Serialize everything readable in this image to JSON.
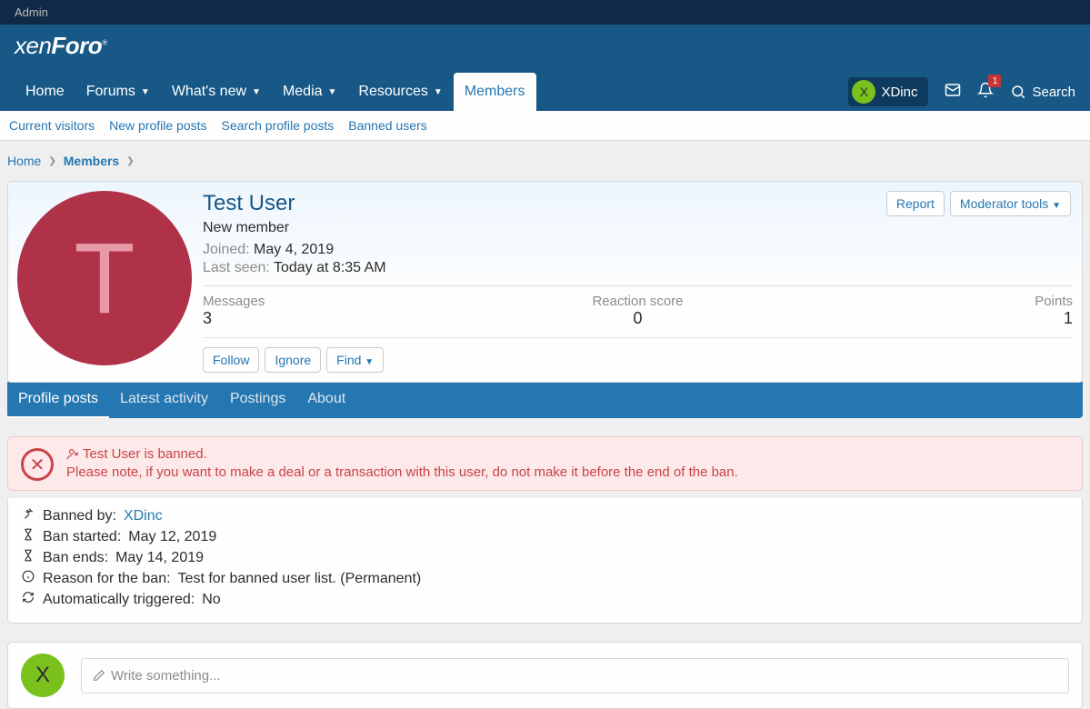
{
  "admin_bar": "Admin",
  "logo_a": "xen",
  "logo_b": "Foro",
  "nav": {
    "home": "Home",
    "forums": "Forums",
    "whats_new": "What's new",
    "media": "Media",
    "resources": "Resources",
    "members": "Members",
    "user": "XDinc",
    "user_initial": "X",
    "alerts": "1",
    "search": "Search"
  },
  "subnav": {
    "current": "Current visitors",
    "new_posts": "New profile posts",
    "search_posts": "Search profile posts",
    "banned": "Banned users"
  },
  "breadcrumb": {
    "home": "Home",
    "members": "Members"
  },
  "profile": {
    "initial": "T",
    "name": "Test User",
    "title": "New member",
    "joined_label": "Joined:",
    "joined": "May 4, 2019",
    "seen_label": "Last seen:",
    "seen": "Today at 8:35 AM",
    "report": "Report",
    "mod_tools": "Moderator tools",
    "follow": "Follow",
    "ignore": "Ignore",
    "find": "Find",
    "stats": {
      "messages_label": "Messages",
      "messages": "3",
      "reaction_label": "Reaction score",
      "reaction": "0",
      "points_label": "Points",
      "points": "1"
    }
  },
  "tabs": {
    "profile": "Profile posts",
    "latest": "Latest activity",
    "postings": "Postings",
    "about": "About"
  },
  "alert": {
    "line1": "Test User is banned.",
    "line2": "Please note, if you want to make a deal or a transaction with this user, do not make it before the end of the ban."
  },
  "ban": {
    "by_label": "Banned by:",
    "by": "XDinc",
    "start_label": "Ban started:",
    "start": "May 12, 2019",
    "end_label": "Ban ends:",
    "end": "May 14, 2019",
    "reason_label": "Reason for the ban:",
    "reason": "Test for banned user list. (Permanent)",
    "auto_label": "Automatically triggered:",
    "auto": "No"
  },
  "compose": {
    "initial": "X",
    "placeholder": "Write something..."
  }
}
